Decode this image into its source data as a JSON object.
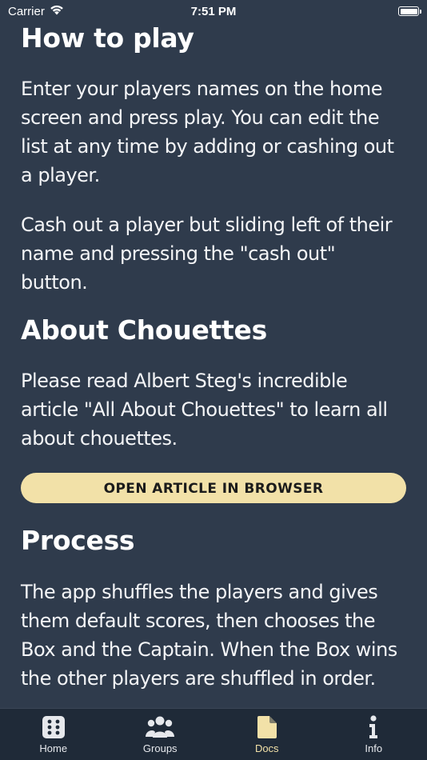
{
  "status_bar": {
    "carrier": "Carrier",
    "time": "7:51 PM"
  },
  "content": {
    "how_to_play_heading": "How to play",
    "how_to_play_p1": "Enter your players names on the home screen and press play. You can edit the list at any time by adding or cashing out a player.",
    "how_to_play_p2": "Cash out a player but sliding left of their name and pressing the \"cash out\" button.",
    "about_heading": "About Chouettes",
    "about_p1": "Please read Albert Steg's incredible article \"All About Chouettes\" to learn all about chouettes.",
    "open_article_label": "OPEN ARTICLE IN BROWSER",
    "process_heading": "Process",
    "process_p1": "The app shuffles the players and gives them default scores, then chooses the Box and the Captain. When the Box wins the other players are shuffled in order. When the Captain wins they become the"
  },
  "tabs": [
    {
      "label": "Home",
      "icon": "grid-icon",
      "active": false
    },
    {
      "label": "Groups",
      "icon": "group-icon",
      "active": false
    },
    {
      "label": "Docs",
      "icon": "document-icon",
      "active": true
    },
    {
      "label": "Info",
      "icon": "info-icon",
      "active": false
    }
  ],
  "colors": {
    "background": "#2f3b4c",
    "tab_bar": "#1f2a38",
    "accent": "#f2e1a8"
  }
}
